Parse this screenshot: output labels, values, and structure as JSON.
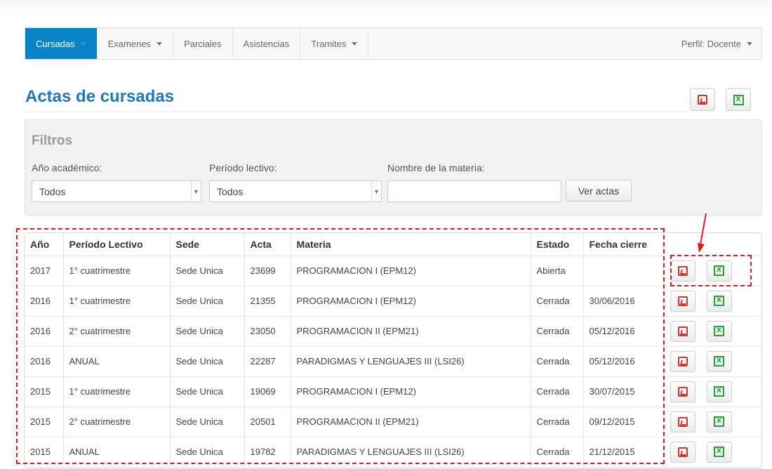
{
  "nav": {
    "items": [
      {
        "label": "Cursadas",
        "dropdown": true,
        "active": true
      },
      {
        "label": "Examenes",
        "dropdown": true,
        "active": false
      },
      {
        "label": "Parciales",
        "dropdown": false,
        "active": false
      },
      {
        "label": "Asistencias",
        "dropdown": false,
        "active": false
      },
      {
        "label": "Tramites",
        "dropdown": true,
        "active": false
      }
    ],
    "profile": "Perfil: Docente"
  },
  "page": {
    "title": "Actas de cursadas",
    "export_icons": [
      "pdf-icon",
      "excel-icon"
    ]
  },
  "filters": {
    "title": "Filtros",
    "anio_label": "Año académico:",
    "anio_value": "Todos",
    "periodo_label": "Período lectivo:",
    "periodo_value": "Todos",
    "materia_label": "Nombre de la materia:",
    "materia_value": "",
    "submit_label": "Ver actas"
  },
  "table": {
    "columns": [
      "Año",
      "Período Lectivo",
      "Sede",
      "Acta",
      "Materia",
      "Estado",
      "Fecha cierre"
    ],
    "rows": [
      [
        "2017",
        "1° cuatrimestre",
        "Sede Unica",
        "23699",
        "PROGRAMACION I (EPM12)",
        "Abierta",
        ""
      ],
      [
        "2016",
        "1° cuatrimestre",
        "Sede Unica",
        "21355",
        "PROGRAMACION I (EPM12)",
        "Cerrada",
        "30/06/2016"
      ],
      [
        "2016",
        "2° cuatrimestre",
        "Sede Unica",
        "23050",
        "PROGRAMACION II (EPM21)",
        "Cerrada",
        "05/12/2016"
      ],
      [
        "2016",
        "ANUAL",
        "Sede Unica",
        "22287",
        "PARADIGMAS Y LENGUAJES III (LSI26)",
        "Cerrada",
        "05/12/2016"
      ],
      [
        "2015",
        "1° cuatrimestre",
        "Sede Unica",
        "19069",
        "PROGRAMACION I (EPM12)",
        "Cerrada",
        "30/07/2015"
      ],
      [
        "2015",
        "2° cuatrimestre",
        "Sede Unica",
        "20501",
        "PROGRAMACION II (EPM21)",
        "Cerrada",
        "09/12/2015"
      ],
      [
        "2015",
        "ANUAL",
        "Sede Unica",
        "19782",
        "PARADIGMAS Y LENGUAJES III (LSI26)",
        "Cerrada",
        "21/12/2015"
      ]
    ]
  },
  "colors": {
    "nav_active": "#0a84c6",
    "title": "#1f78b4",
    "annotation": "#e0191f",
    "pdf": "#d0342c",
    "excel": "#2e9e3e"
  }
}
